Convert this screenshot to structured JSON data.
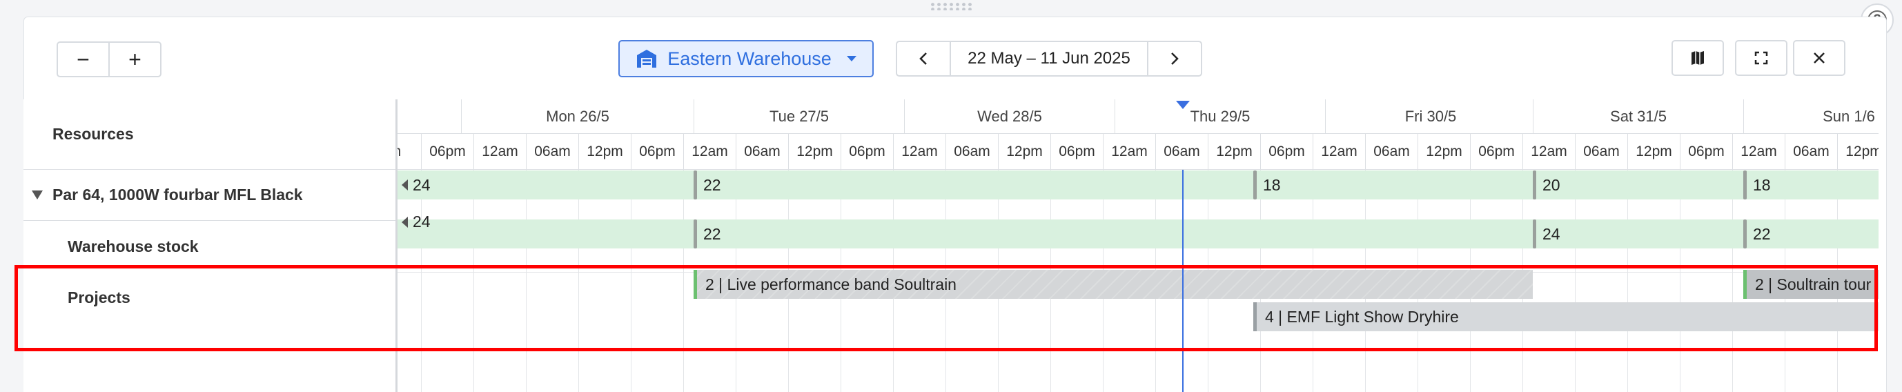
{
  "toolbar": {
    "zoom_out": "−",
    "zoom_in": "+",
    "warehouse": "Eastern Warehouse",
    "date_range": "22 May – 11 Jun 2025",
    "prev": "‹",
    "next": "›",
    "help": "?"
  },
  "resources": {
    "header": "Resources",
    "rows": [
      {
        "label": "Par 64, 1000W fourbar MFL Black"
      },
      {
        "label": "Warehouse stock"
      },
      {
        "label": "Projects"
      }
    ]
  },
  "days": [
    "Mon 26/5",
    "Tue 27/5",
    "Wed 28/5",
    "Thu 29/5",
    "Fri 30/5",
    "Sat 31/5",
    "Sun 1/6"
  ],
  "times": [
    "m",
    "06pm",
    "12am",
    "06am",
    "12pm",
    "06pm",
    "12am",
    "06am",
    "12pm",
    "06pm",
    "12am",
    "06am",
    "12pm",
    "06pm",
    "12am",
    "06am",
    "12pm",
    "06pm",
    "12am",
    "06am",
    "12pm",
    "06pm",
    "12am",
    "06am",
    "12pm",
    "06pm",
    "12am",
    "06am",
    "12pm"
  ],
  "availability": {
    "par64": [
      "24",
      "22",
      "18",
      "20",
      "18"
    ],
    "warehouse": [
      "24",
      "22",
      "24",
      "22"
    ]
  },
  "projects": [
    {
      "label": "2 | Live performance band Soultrain"
    },
    {
      "label": "4 | EMF Light Show Dryhire"
    },
    {
      "label": "2 | Soultrain tour"
    }
  ],
  "colors": {
    "accent": "#2f6fdf",
    "available": "#d9f1df",
    "now_line": "#3a6fe0",
    "highlight": "#ff0000"
  },
  "icons": [
    "warehouse-icon",
    "map-icon",
    "fullscreen-icon",
    "close-icon",
    "help-icon"
  ]
}
